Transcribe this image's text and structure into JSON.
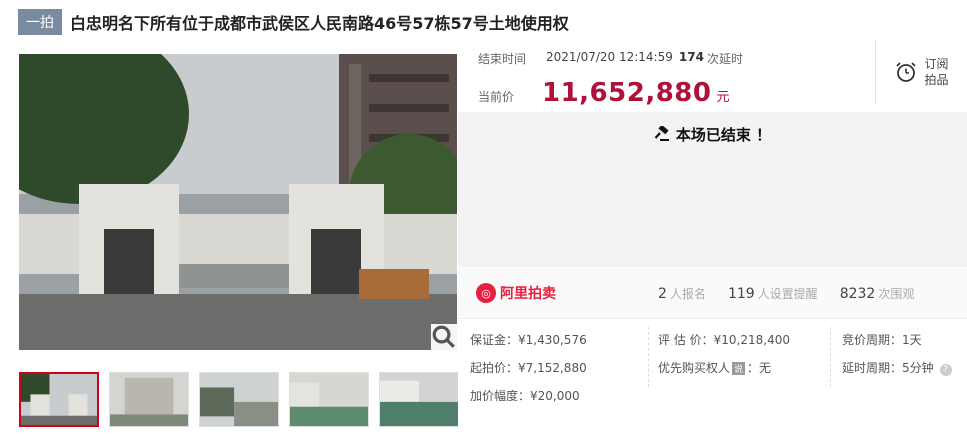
{
  "header": {
    "badge": "一拍",
    "title": "白忠明名下所有位于成都市武侯区人民南路46号57栋57号土地使用权"
  },
  "auction": {
    "end_label": "结束时间",
    "end_time": "2021/07/20 12:14:59",
    "extensions": "174",
    "extensions_label": "次延时",
    "subscribe_line1": "订阅",
    "subscribe_line2": "拍品",
    "price_label": "当前价",
    "price": "11,652,880",
    "price_unit": "元",
    "ended_message": "本场已结束 ！"
  },
  "stats": {
    "brand": "阿里拍卖",
    "registrations": "2",
    "registrations_label": "人报名",
    "reminders": "119",
    "reminders_label": "人设置提醒",
    "views": "8232",
    "views_label": "次围观"
  },
  "details": {
    "deposit": "保证金：¥1,430,576",
    "start_price": "起拍价：¥7,152,880",
    "increment": "加价幅度：¥20,000",
    "appraisal": "评 估 价：¥10,218,400",
    "priority_label": "优先购买权人",
    "priority_tag": "说",
    "priority_value": "：无",
    "bid_period": "竞价周期：1天",
    "extension_period": "延时周期：5分钟"
  },
  "icons": {
    "clock": "alarm-clock-icon",
    "gavel": "gavel-icon",
    "zoom": "magnifier-icon",
    "help": "question-icon"
  },
  "colors": {
    "price": "#b0113a",
    "brand": "#e8203f",
    "badge": "#7a8aa0",
    "thumb_active": "#d0021b"
  }
}
